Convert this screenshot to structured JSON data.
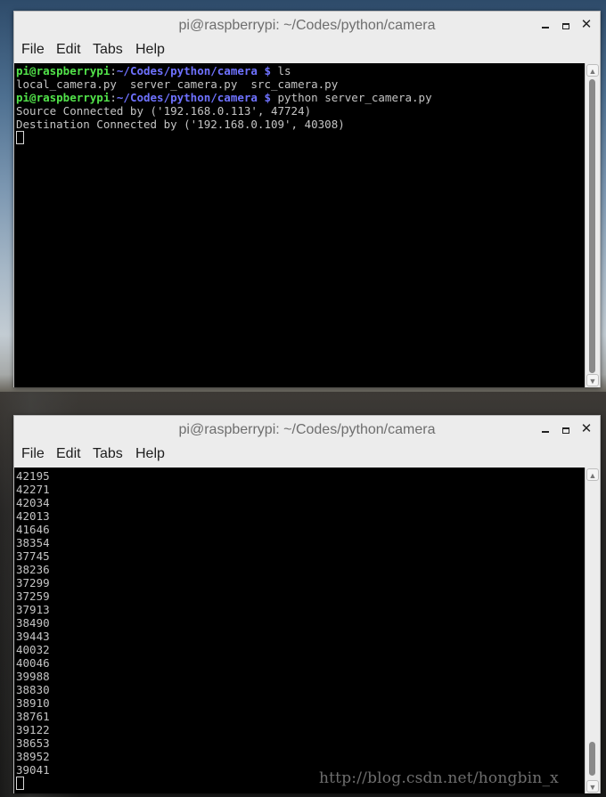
{
  "colors": {
    "prompt_user": "#52e34a",
    "prompt_path": "#6f72ff",
    "terminal_bg": "#000000",
    "terminal_fg": "#c4c4c4",
    "window_chrome": "#ececec"
  },
  "window1": {
    "title": "pi@raspberrypi: ~/Codes/python/camera",
    "menu": [
      "File",
      "Edit",
      "Tabs",
      "Help"
    ],
    "lines": [
      {
        "user": "pi@raspberrypi",
        "sep": ":",
        "path": "~/Codes/python/camera $",
        "cmd": " ls"
      },
      {
        "text": "local_camera.py  server_camera.py  src_camera.py"
      },
      {
        "user": "pi@raspberrypi",
        "sep": ":",
        "path": "~/Codes/python/camera $",
        "cmd": " python server_camera.py"
      },
      {
        "text": "Source Connected by ('192.168.0.113', 47724)"
      },
      {
        "text": "Destination Connected by ('192.168.0.109', 40308)"
      }
    ]
  },
  "window2": {
    "title": "pi@raspberrypi: ~/Codes/python/camera",
    "menu": [
      "File",
      "Edit",
      "Tabs",
      "Help"
    ],
    "lines": [
      "42195",
      "42271",
      "42034",
      "42013",
      "41646",
      "38354",
      "37745",
      "38236",
      "37299",
      "37259",
      "37913",
      "38490",
      "39443",
      "40032",
      "40046",
      "39988",
      "38830",
      "38910",
      "38761",
      "39122",
      "38653",
      "38952",
      "39041"
    ]
  },
  "watermark": "http://blog.csdn.net/hongbin_x"
}
